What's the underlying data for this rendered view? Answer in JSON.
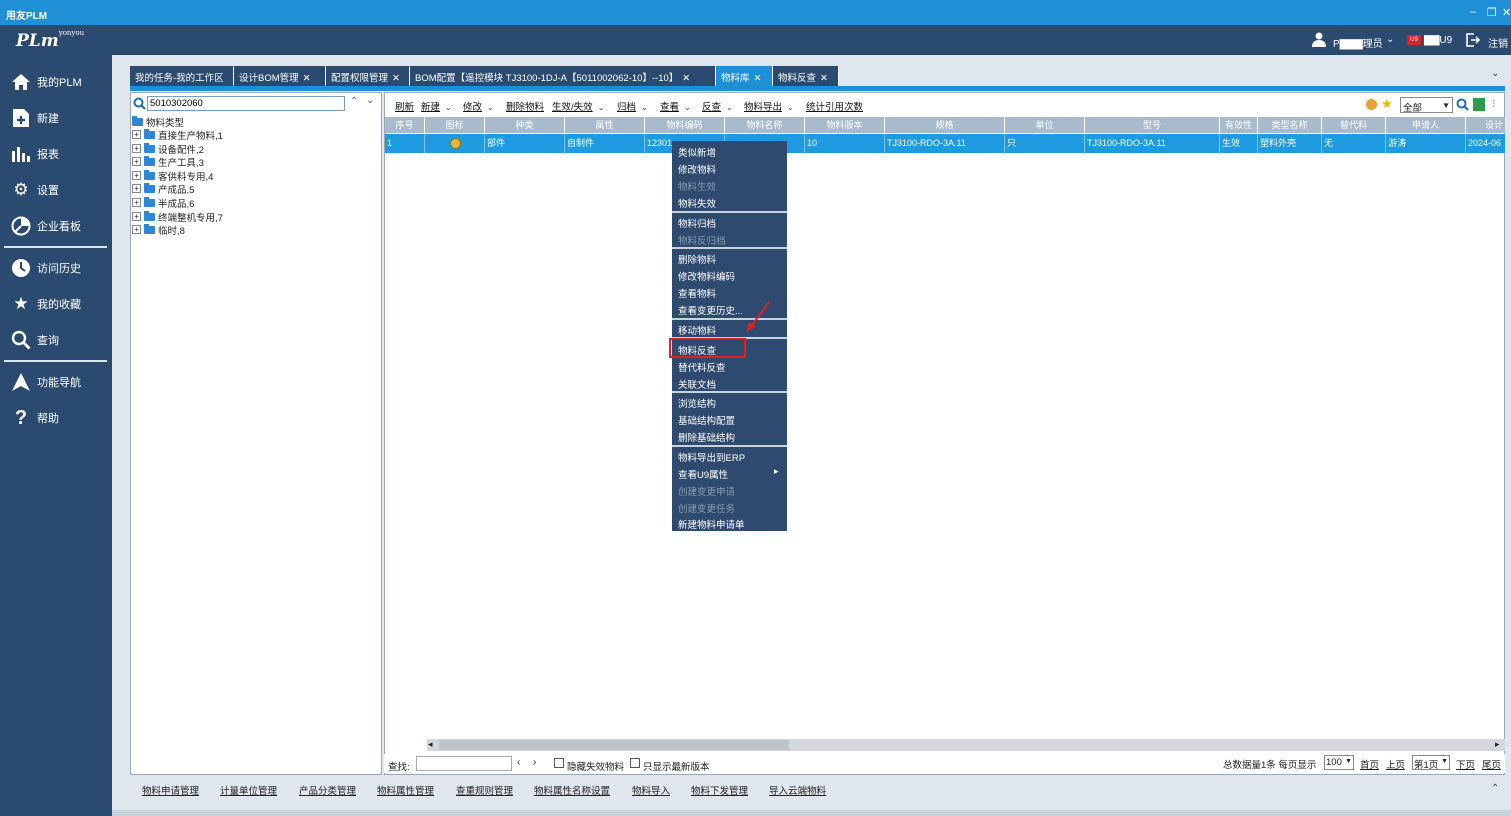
{
  "window": {
    "title": "用友PLM",
    "minimize": "–",
    "restore": "❐",
    "close": "✕"
  },
  "header": {
    "logo": "PLm",
    "logo_sup": "yonyou",
    "user_label": "P▇▇▇理员",
    "u9_badge": "U9",
    "u9_label": "▇▇U9",
    "logout": "注销"
  },
  "sidebar": {
    "items": [
      {
        "label": "我的PLM",
        "icon": "home-icon"
      },
      {
        "label": "新建",
        "icon": "new-document-icon"
      },
      {
        "label": "报表",
        "icon": "bar-chart-icon"
      },
      {
        "label": "设置",
        "icon": "gear-icon"
      },
      {
        "label": "企业看板",
        "icon": "pie-chart-icon"
      },
      {
        "label": "访问历史",
        "icon": "history-icon"
      },
      {
        "label": "我的收藏",
        "icon": "star-icon"
      },
      {
        "label": "查询",
        "icon": "search-icon"
      },
      {
        "label": "功能导航",
        "icon": "navigation-icon"
      },
      {
        "label": "帮助",
        "icon": "help-icon"
      }
    ]
  },
  "tabs": [
    {
      "label": "我的任务-我的工作区",
      "closable": false
    },
    {
      "label": "设计BOM管理",
      "closable": true
    },
    {
      "label": "配置权限管理",
      "closable": true
    },
    {
      "label": "BOM配置【遥控模块  TJ3100-1DJ-A【5011002062-10】--10】",
      "closable": true
    },
    {
      "label": "物料库",
      "closable": true,
      "active": true
    },
    {
      "label": "物料反查",
      "closable": true
    }
  ],
  "tree": {
    "search_value": "5010302060",
    "root": "物料类型",
    "nodes": [
      "直接生产物料,1",
      "设备配件,2",
      "生产工具,3",
      "客供料专用,4",
      "产成品,5",
      "半成品,6",
      "终端整机专用,7",
      "临时,8"
    ]
  },
  "toolbar": {
    "buttons": [
      {
        "label": "刷新",
        "dropdown": false
      },
      {
        "label": "新建",
        "dropdown": true
      },
      {
        "label": "修改",
        "dropdown": true
      },
      {
        "label": "删除物料",
        "dropdown": false
      },
      {
        "label": "生效/失效",
        "dropdown": true
      },
      {
        "label": "归档",
        "dropdown": true
      },
      {
        "label": "查看",
        "dropdown": true
      },
      {
        "label": "反查",
        "dropdown": true
      },
      {
        "label": "物料导出",
        "dropdown": true
      },
      {
        "label": "统计引用次数",
        "dropdown": false
      }
    ],
    "scope_select": "全部"
  },
  "grid": {
    "columns": [
      "序号",
      "图标",
      "种类",
      "属性",
      "物料编码",
      "物料名称",
      "物料版本",
      "规格",
      "单位",
      "型号",
      "有效性",
      "类型名称",
      "替代料",
      "申请人",
      "设计"
    ],
    "rows": [
      [
        "1",
        "",
        "部件",
        "自制件",
        "12301",
        "",
        "10",
        "TJ3100-RDO-3A.11",
        "只",
        "TJ3100-RDO-3A.11",
        "生效",
        "塑料外壳",
        "无",
        "游涛",
        "2024-06"
      ]
    ]
  },
  "context_menu": {
    "groups": [
      [
        {
          "label": "类似新增",
          "enabled": true
        },
        {
          "label": "修改物料",
          "enabled": true
        },
        {
          "label": "物料生效",
          "enabled": false
        },
        {
          "label": "物料失效",
          "enabled": true
        }
      ],
      [
        {
          "label": "物料归档",
          "enabled": true
        },
        {
          "label": "物料反归档",
          "enabled": false
        }
      ],
      [
        {
          "label": "删除物料",
          "enabled": true
        },
        {
          "label": "修改物料编码",
          "enabled": true
        },
        {
          "label": "查看物料",
          "enabled": true
        },
        {
          "label": "查看变更历史...",
          "enabled": true
        }
      ],
      [
        {
          "label": "移动物料",
          "enabled": true
        }
      ],
      [
        {
          "label": "物料反查",
          "enabled": true,
          "highlighted": true
        },
        {
          "label": "替代料反查",
          "enabled": true
        },
        {
          "label": "关联文档",
          "enabled": true
        }
      ],
      [
        {
          "label": "浏览结构",
          "enabled": true
        },
        {
          "label": "基础结构配置",
          "enabled": true
        },
        {
          "label": "删除基础结构",
          "enabled": true
        }
      ],
      [
        {
          "label": "物料导出到ERP",
          "enabled": true
        },
        {
          "label": "查看U9属性",
          "enabled": true,
          "submenu": true
        },
        {
          "label": "创建变更申请",
          "enabled": false
        },
        {
          "label": "创建变更任务",
          "enabled": false
        },
        {
          "label": "新建物料申请单",
          "enabled": true
        }
      ]
    ],
    "submenu_arrow": "▸"
  },
  "findbar": {
    "label": "查找:",
    "hide_invalid": "隐藏失效物料",
    "latest_only": "只显示最新版本",
    "total": "总数据量1条 每页显示",
    "page_size": "100",
    "first": "首页",
    "prev": "上页",
    "page": "第1页",
    "next": "下页",
    "last": "尾页"
  },
  "bottom_links": [
    "物料申请管理",
    "计量单位管理",
    "产品分类管理",
    "物料属性管理",
    "查重规则管理",
    "物料属性名称设置",
    "物料导入",
    "物料下发管理",
    "导入云端物料"
  ],
  "colors": {
    "sidebar": "#2b4a6f",
    "accent": "#1f8fd6",
    "selected_row": "#1e9ae0",
    "highlight": "#e02020"
  }
}
